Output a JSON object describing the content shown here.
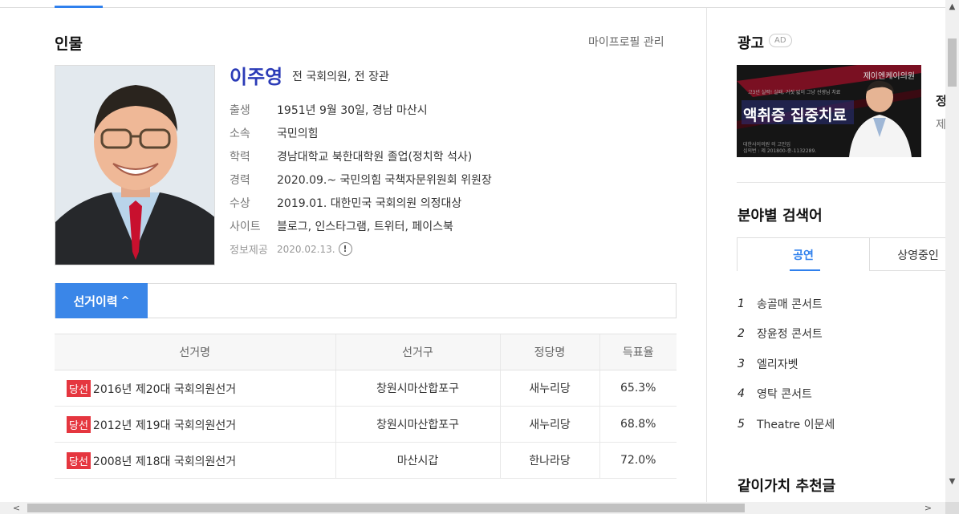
{
  "profile": {
    "section_title": "인물",
    "manage_link": "마이프로필 관리",
    "name": "이주영",
    "name_sub": "전 국회의원, 전 장관",
    "rows": [
      {
        "key": "출생",
        "value": "1951년 9월 30일, 경남 마산시"
      },
      {
        "key": "소속",
        "value": "국민의힘"
      },
      {
        "key": "학력",
        "value": "경남대학교 북한대학원 졸업(정치학 석사)"
      },
      {
        "key": "경력",
        "value": "2020.09.~ 국민의힘 국책자문위원회 위원장"
      },
      {
        "key": "수상",
        "value": "2019.01. 대한민국 국회의원 의정대상"
      },
      {
        "key": "사이트",
        "value": "블로그, 인스타그램, 트위터, 페이스북"
      }
    ],
    "info_label": "정보제공",
    "info_date": "2020.02.13."
  },
  "election": {
    "tab_label": "선거이력",
    "tab_chevron": "^",
    "headers": [
      "선거명",
      "선거구",
      "정당명",
      "득표율"
    ],
    "rows": [
      {
        "badge": "당선",
        "name": "2016년 제20대 국회의원선거",
        "district": "창원시마산합포구",
        "party": "새누리당",
        "rate": "65.3%"
      },
      {
        "badge": "당선",
        "name": "2012년 제19대 국회의원선거",
        "district": "창원시마산합포구",
        "party": "새누리당",
        "rate": "68.8%"
      },
      {
        "badge": "당선",
        "name": "2008년 제18대 국회의원선거",
        "district": "마산시갑",
        "party": "한나라당",
        "rate": "72.0%"
      }
    ]
  },
  "ad": {
    "title": "광고",
    "badge": "AD",
    "banner_top": "제이엔케이의원",
    "banner_small": "고3년 실력! 실패, 거짓 없이 그냥 선생님 치료",
    "banner_main": "액취증 집중치료",
    "banner_foot1": "대한사이의원 의 고민입",
    "banner_foot2": "심의번 : 제 201800-중-1132289.",
    "cut_title": "정",
    "cut_text": "제"
  },
  "category": {
    "title": "분야별 검색어",
    "tabs": [
      "공연",
      "상영중인"
    ],
    "items": [
      {
        "rank": "1",
        "label": "송골매 콘서트"
      },
      {
        "rank": "2",
        "label": "장윤정 콘서트"
      },
      {
        "rank": "3",
        "label": "엘리자벳"
      },
      {
        "rank": "4",
        "label": "영탁 콘서트"
      },
      {
        "rank": "5",
        "label": "Theatre 이문세"
      }
    ]
  },
  "together": {
    "title": "같이가치 추천글"
  },
  "icons": {
    "info_icon": "exclamation-circle-icon",
    "scroll_up": "arrow-up-icon",
    "scroll_down": "arrow-down-icon",
    "scroll_left": "arrow-left-icon",
    "scroll_right": "arrow-right-icon"
  },
  "colors": {
    "accent": "#3a86e8",
    "name": "#2b3bb7",
    "badge": "#e5363f"
  }
}
